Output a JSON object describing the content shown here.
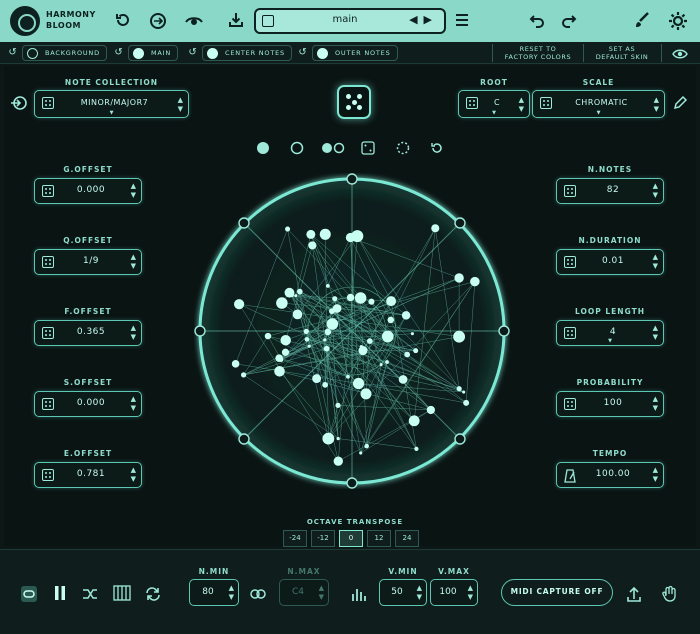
{
  "app": {
    "name_line1": "HARMONY",
    "name_line2": "BLOOM"
  },
  "topbar": {
    "preset_name": "main",
    "icons": [
      "reset-icon",
      "sync-icon",
      "eye-icon",
      "save-icon",
      "menu-icon",
      "undo-icon",
      "redo-icon",
      "brush-icon",
      "settings-icon"
    ]
  },
  "layers": [
    {
      "label": "BACKGROUND"
    },
    {
      "label": "MAIN"
    },
    {
      "label": "CENTER NOTES"
    },
    {
      "label": "OUTER NOTES"
    }
  ],
  "subbar": {
    "reset_factory_line1": "RESET TO",
    "reset_factory_line2": "FACTORY COLORS",
    "set_default_line1": "SET AS",
    "set_default_line2": "DEFAULT SKIN"
  },
  "note_collection": {
    "label": "NOTE COLLECTION",
    "value": "MINOR/MAJOR7"
  },
  "root": {
    "label": "ROOT",
    "value": "C"
  },
  "scale": {
    "label": "SCALE",
    "value": "CHROMATIC"
  },
  "left_params": [
    {
      "label": "G.OFFSET",
      "value": "0.000"
    },
    {
      "label": "Q.OFFSET",
      "value": "1/9"
    },
    {
      "label": "F.OFFSET",
      "value": "0.365"
    },
    {
      "label": "S.OFFSET",
      "value": "0.000"
    },
    {
      "label": "E.OFFSET",
      "value": "0.781"
    }
  ],
  "right_params": [
    {
      "label": "N.NOTES",
      "value": "82"
    },
    {
      "label": "N.DURATION",
      "value": "0.01"
    },
    {
      "label": "LOOP LENGTH",
      "value": "4"
    },
    {
      "label": "PROBABILITY",
      "value": "100"
    },
    {
      "label": "TEMPO",
      "value": "100.00"
    }
  ],
  "octave_transpose": {
    "label": "OCTAVE TRANSPOSE",
    "options": [
      "-24",
      "-12",
      "0",
      "12",
      "24"
    ],
    "selected": "0"
  },
  "bottom": {
    "n_min": {
      "label": "N.MIN",
      "value": "80"
    },
    "n_max": {
      "label": "N.MAX",
      "value": "C4"
    },
    "v_min": {
      "label": "V.MIN",
      "value": "50"
    },
    "v_max": {
      "label": "V.MAX",
      "value": "100"
    },
    "midi_capture": "MIDI CAPTURE OFF"
  },
  "colors": {
    "accent": "#8ad9c8",
    "panel": "#0c1716",
    "glow": "#7ce8d3",
    "node": "#c9fff3"
  }
}
